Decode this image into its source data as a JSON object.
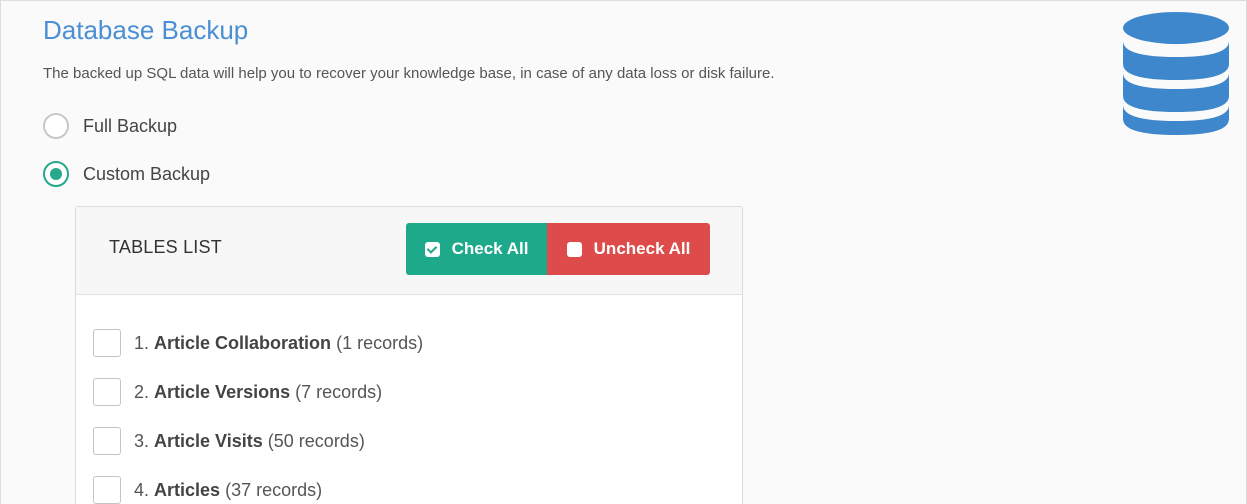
{
  "page": {
    "title": "Database Backup",
    "description": "The backed up SQL data will help you to recover your knowledge base, in case of any data loss or disk failure.",
    "icon": "database-icon",
    "accent_color": "#4a8fd3"
  },
  "backup_options": [
    {
      "label": "Full Backup",
      "selected": false
    },
    {
      "label": "Custom Backup",
      "selected": true
    }
  ],
  "tables_panel": {
    "title": "TABLES LIST",
    "check_all_label": "Check All",
    "uncheck_all_label": "Uncheck All",
    "check_all_color": "#1fa98b",
    "uncheck_all_color": "#dd4b4b",
    "items": [
      {
        "number": "1.",
        "name": "Article Collaboration",
        "count": "(1 records)",
        "checked": false
      },
      {
        "number": "2.",
        "name": "Article Versions",
        "count": "(7 records)",
        "checked": false
      },
      {
        "number": "3.",
        "name": "Article Visits",
        "count": "(50 records)",
        "checked": false
      },
      {
        "number": "4.",
        "name": "Articles",
        "count": "(37 records)",
        "checked": false
      }
    ]
  }
}
